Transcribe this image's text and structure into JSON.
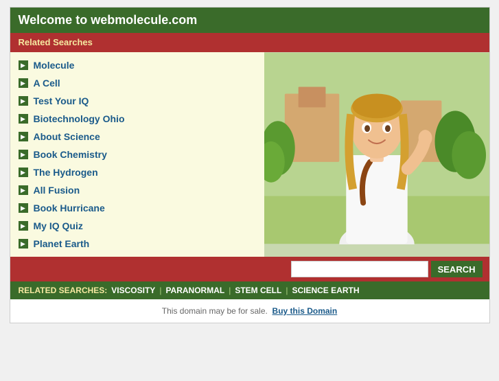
{
  "header": {
    "title": "Welcome to webmolecule.com"
  },
  "related_searches_bar": {
    "label": "Related Searches"
  },
  "links": [
    {
      "id": "molecule",
      "text": "Molecule"
    },
    {
      "id": "a-cell",
      "text": "A Cell"
    },
    {
      "id": "test-your-iq",
      "text": "Test Your IQ"
    },
    {
      "id": "biotechnology-ohio",
      "text": "Biotechnology Ohio"
    },
    {
      "id": "about-science",
      "text": "About Science"
    },
    {
      "id": "book-chemistry",
      "text": "Book Chemistry"
    },
    {
      "id": "the-hydrogen",
      "text": "The Hydrogen"
    },
    {
      "id": "all-fusion",
      "text": "All Fusion"
    },
    {
      "id": "book-hurricane",
      "text": "Book Hurricane"
    },
    {
      "id": "my-iq-quiz",
      "text": "My IQ Quiz"
    },
    {
      "id": "planet-earth",
      "text": "Planet Earth"
    }
  ],
  "search": {
    "placeholder": "",
    "button_label": "SEARCH"
  },
  "bottom_related": {
    "label": "RELATED SEARCHES:",
    "items": [
      {
        "id": "viscosity",
        "text": "VISCOSITY"
      },
      {
        "id": "paranormal",
        "text": "PARANORMAL"
      },
      {
        "id": "stem-cell",
        "text": "STEM CELL"
      },
      {
        "id": "science-earth",
        "text": "SCIENCE EARTH"
      }
    ]
  },
  "footer": {
    "text": "This domain may be for sale.",
    "link_text": "Buy this Domain"
  },
  "colors": {
    "dark_green": "#3a6b2a",
    "red": "#b03030",
    "light_yellow": "#fafae0",
    "link_blue": "#1a5a8a"
  }
}
